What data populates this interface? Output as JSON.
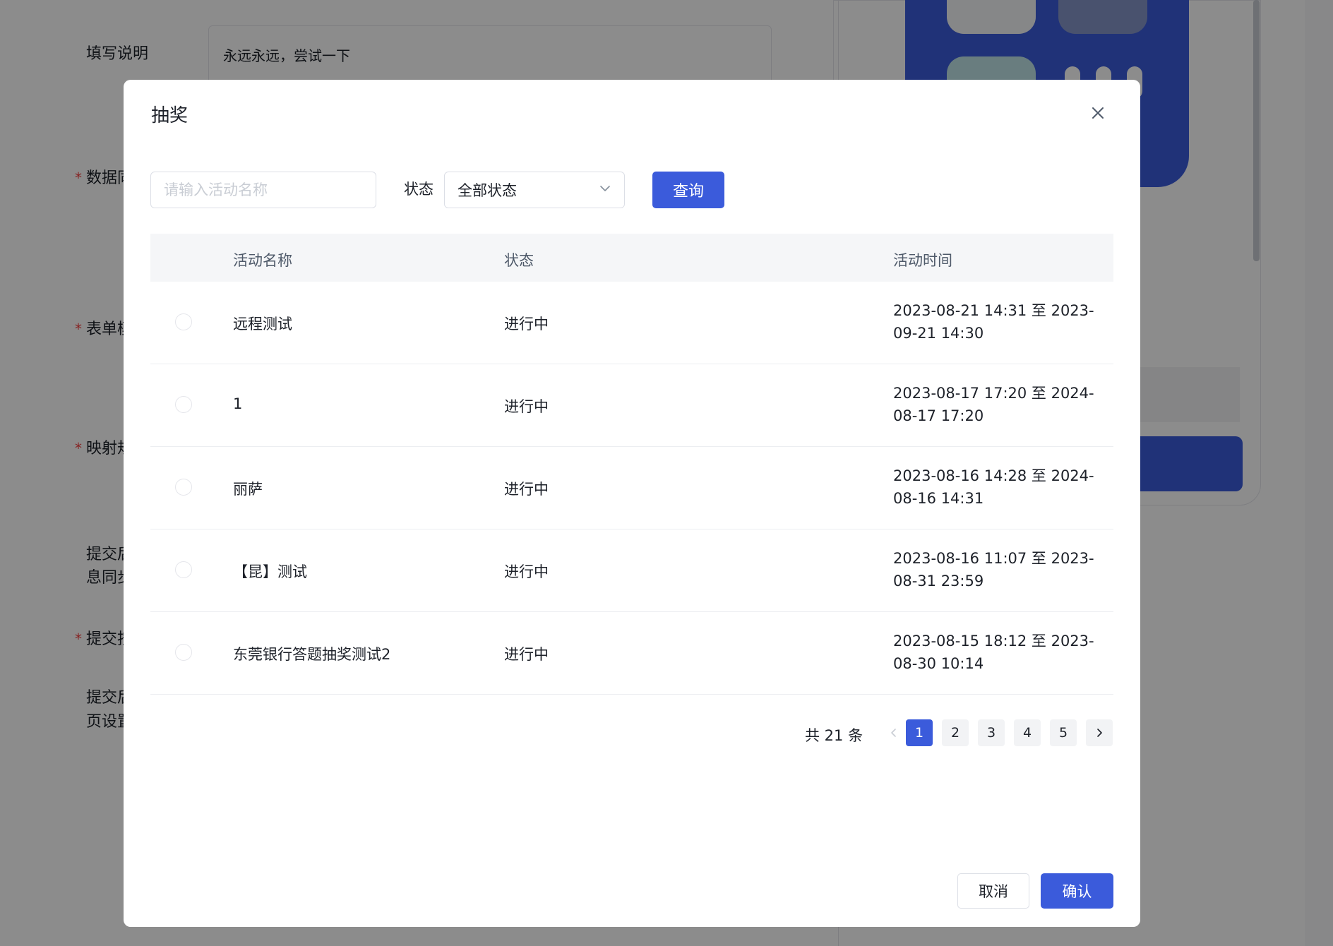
{
  "background": {
    "labels": [
      {
        "text": "填写说明",
        "required": false
      },
      {
        "text": "数据同",
        "required": true
      },
      {
        "text": "表单模",
        "required": true
      },
      {
        "text": "映射规",
        "required": true
      },
      {
        "text": "提交后",
        "required": false
      },
      {
        "text": "息同步",
        "required": false
      },
      {
        "text": "提交按",
        "required": true
      },
      {
        "text": "提交后",
        "required": false
      },
      {
        "text": "页设置",
        "required": false
      }
    ],
    "description_value": "永远永远，尝试一下"
  },
  "modal": {
    "title": "抽奖",
    "search": {
      "placeholder": "请输入活动名称",
      "value": ""
    },
    "status_label": "状态",
    "status_select_value": "全部状态",
    "query_label": "查询",
    "columns": [
      "活动名称",
      "状态",
      "活动时间"
    ],
    "rows": [
      {
        "name": "远程测试",
        "status": "进行中",
        "time": "2023-08-21 14:31 至 2023-09-21 14:30"
      },
      {
        "name": "1",
        "status": "进行中",
        "time": "2023-08-17 17:20 至 2024-08-17 17:20"
      },
      {
        "name": "丽萨",
        "status": "进行中",
        "time": "2023-08-16 14:28 至 2024-08-16 14:31"
      },
      {
        "name": "【昆】测试",
        "status": "进行中",
        "time": "2023-08-16 11:07 至 2023-08-31 23:59"
      },
      {
        "name": "东莞银行答题抽奖测试2",
        "status": "进行中",
        "time": "2023-08-15 18:12 至 2023-08-30 10:14"
      }
    ],
    "pagination": {
      "total_text": "共 21 条",
      "pages": [
        "1",
        "2",
        "3",
        "4",
        "5"
      ],
      "current_page": "1"
    },
    "cancel_label": "取消",
    "confirm_label": "确认"
  },
  "colors": {
    "primary": "#3b5bdb",
    "required": "#f53f3f"
  }
}
